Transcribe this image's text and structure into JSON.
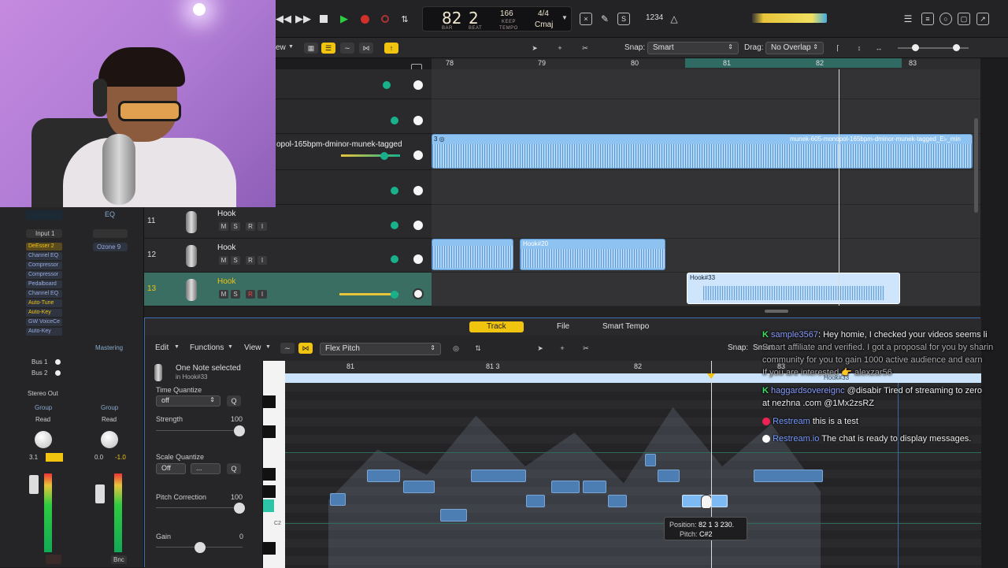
{
  "transport": {
    "bar": "82",
    "beat": "2",
    "bar_label": "BAR",
    "beat_label": "BEAT",
    "tempo": "166",
    "tempo_label_1": "KEEP",
    "tempo_label_2": "TEMPO",
    "sig": "4/4",
    "key": "Cmaj",
    "count": "1234"
  },
  "toolbar": {
    "view_label": "ew",
    "snap_label": "Snap:",
    "snap_value": "Smart",
    "drag_label": "Drag:",
    "drag_value": "No Overlap"
  },
  "ruler": {
    "m78": "78",
    "m79": "79",
    "m80": "80",
    "m81": "81",
    "m82": "82",
    "m83": "83"
  },
  "tracks": {
    "audio_name": "opol-165bpm-dminor-munek-tagged",
    "region_top_name": "munek-605-monopol-165bpm-dminor-munek-tagged_E♭_min",
    "t11": {
      "num": "11",
      "name": "Hook"
    },
    "t12": {
      "num": "12",
      "name": "Hook"
    },
    "t13": {
      "num": "13",
      "name": "Hook"
    },
    "region_20": "Hook#20",
    "region_33": "Hook#33",
    "btn_m": "M",
    "btn_s": "S",
    "btn_r": "R",
    "btn_i": "I"
  },
  "inspector": {
    "eq": "EQ",
    "input": "Input 1",
    "ozone": "Ozone 9",
    "plugins": [
      "DeEsser 2",
      "Channel EQ",
      "Compressor",
      "Compressor",
      "Pedalboard",
      "Channel EQ",
      "Auto-Tune",
      "Auto-Key",
      "GW VoiceCe",
      "Auto-Key"
    ],
    "mastering": "Mastering",
    "bus1": "Bus 1",
    "bus2": "Bus 2",
    "stereo_out": "Stereo Out",
    "group": "Group",
    "read": "Read",
    "vol_left": "3.1",
    "vol_mid": "0.0",
    "vol_right": "-1.0",
    "bnc": "Bnc"
  },
  "editor": {
    "tab_track": "Track",
    "tab_file": "File",
    "tab_smart_tempo": "Smart Tempo",
    "edit": "Edit",
    "functions": "Functions",
    "view": "View",
    "mode": "Flex Pitch",
    "snap_label": "Snap:",
    "snap_value": "Smart",
    "selected": "One Note selected",
    "selected_in": "in Hook#33",
    "time_quantize": "Time Quantize",
    "tq_value": "off",
    "q": "Q",
    "strength": "Strength",
    "strength_value": "100",
    "scale_quantize": "Scale Quantize",
    "sq_value": "Off",
    "sq_value2": "...",
    "pitch_correction": "Pitch Correction",
    "pc_value": "100",
    "gain": "Gain",
    "gain_value": "0",
    "r81": "81",
    "r813": "81 3",
    "r82": "82",
    "r83": "83",
    "region_label": "Hook#33",
    "c2": "C2",
    "tooltip_pos_label": "Position:",
    "tooltip_pos": "82 1 3 230.",
    "tooltip_pitch_label": "Pitch:",
    "tooltip_pitch": "C#2"
  },
  "chat": {
    "m1_user": "sample3567",
    "m1_text": "Hey homie, I checked your videos seems li",
    "m1_line2": "Smart affiliate and verified. I got a proposal for you by sharin",
    "m1_line3": "community for you to gain 1000 active audience and earn",
    "m1_line4": "If you are interested 👉 alexzar56",
    "m2_user": "haggardsovereignc",
    "m2_text": "@disabir Tired of streaming to zero",
    "m2_line2": "at nezhna .com @1Mx2zsRZ",
    "m3_user": "Restream",
    "m3_text": "this is a test",
    "m4_user": "Restream.io",
    "m4_text": "The chat is ready to display messages."
  },
  "colors": {
    "accent": "#f1c40f",
    "region_blue": "#8ec2f0",
    "green": "#19b08c",
    "selected_track": "#3a6e63"
  }
}
